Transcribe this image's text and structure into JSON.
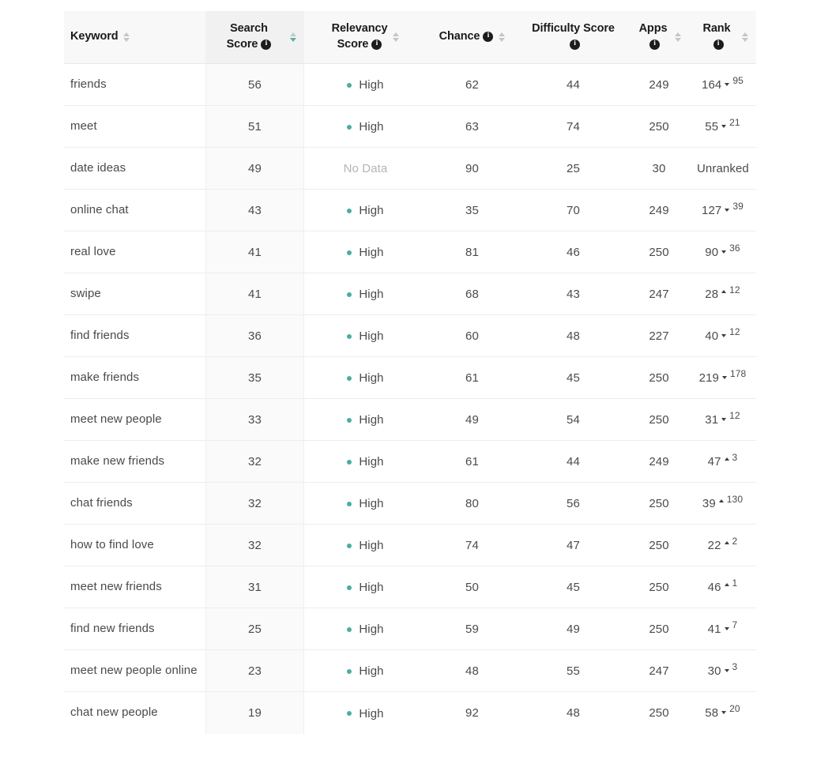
{
  "table": {
    "name": "keyword-research-table",
    "accent_color": "#4aada0",
    "header_bg": "#f8f8f8",
    "active_sort_bg": "#f1f1f1",
    "columns": [
      {
        "key": "keyword",
        "label": "Keyword",
        "has_info": false,
        "sortable": true,
        "active_sort": false,
        "align": "left"
      },
      {
        "key": "search",
        "label": "Search Score",
        "has_info": true,
        "sortable": true,
        "active_sort": true,
        "align": "center"
      },
      {
        "key": "relevancy",
        "label": "Relevancy\nScore",
        "has_info": true,
        "sortable": true,
        "active_sort": false,
        "align": "center"
      },
      {
        "key": "chance",
        "label": "Chance",
        "has_info": true,
        "sortable": true,
        "active_sort": false,
        "align": "center"
      },
      {
        "key": "difficulty",
        "label": "Difficulty Score",
        "has_info": true,
        "sortable": false,
        "active_sort": false,
        "align": "center"
      },
      {
        "key": "apps",
        "label": "Apps",
        "has_info": true,
        "sortable": true,
        "active_sort": false,
        "align": "center"
      },
      {
        "key": "rank",
        "label": "Rank",
        "has_info": true,
        "sortable": true,
        "active_sort": false,
        "align": "center"
      }
    ],
    "icons": {
      "info": "info-icon",
      "sort": "sort-arrows-icon",
      "rank_up": "arrow-up-icon",
      "rank_down": "arrow-down-icon",
      "relevancy_dot": "status-dot-icon"
    },
    "labels": {
      "relevancy_high": "High",
      "relevancy_no_data": "No Data",
      "rank_unranked": "Unranked"
    },
    "rows": [
      {
        "keyword": "friends",
        "search": "56",
        "relevancy": "High",
        "chance": "62",
        "difficulty": "44",
        "apps": "249",
        "rank": "164",
        "rank_dir": "down",
        "rank_delta": "95"
      },
      {
        "keyword": "meet",
        "search": "51",
        "relevancy": "High",
        "chance": "63",
        "difficulty": "74",
        "apps": "250",
        "rank": "55",
        "rank_dir": "down",
        "rank_delta": "21"
      },
      {
        "keyword": "date ideas",
        "search": "49",
        "relevancy": "No Data",
        "chance": "90",
        "difficulty": "25",
        "apps": "30",
        "rank": "Unranked",
        "rank_dir": "none",
        "rank_delta": ""
      },
      {
        "keyword": "online chat",
        "search": "43",
        "relevancy": "High",
        "chance": "35",
        "difficulty": "70",
        "apps": "249",
        "rank": "127",
        "rank_dir": "down",
        "rank_delta": "39"
      },
      {
        "keyword": "real love",
        "search": "41",
        "relevancy": "High",
        "chance": "81",
        "difficulty": "46",
        "apps": "250",
        "rank": "90",
        "rank_dir": "down",
        "rank_delta": "36"
      },
      {
        "keyword": "swipe",
        "search": "41",
        "relevancy": "High",
        "chance": "68",
        "difficulty": "43",
        "apps": "247",
        "rank": "28",
        "rank_dir": "up",
        "rank_delta": "12"
      },
      {
        "keyword": "find friends",
        "search": "36",
        "relevancy": "High",
        "chance": "60",
        "difficulty": "48",
        "apps": "227",
        "rank": "40",
        "rank_dir": "down",
        "rank_delta": "12"
      },
      {
        "keyword": "make friends",
        "search": "35",
        "relevancy": "High",
        "chance": "61",
        "difficulty": "45",
        "apps": "250",
        "rank": "219",
        "rank_dir": "down",
        "rank_delta": "178"
      },
      {
        "keyword": "meet new people",
        "search": "33",
        "relevancy": "High",
        "chance": "49",
        "difficulty": "54",
        "apps": "250",
        "rank": "31",
        "rank_dir": "down",
        "rank_delta": "12"
      },
      {
        "keyword": "make new friends",
        "search": "32",
        "relevancy": "High",
        "chance": "61",
        "difficulty": "44",
        "apps": "249",
        "rank": "47",
        "rank_dir": "up",
        "rank_delta": "3"
      },
      {
        "keyword": "chat friends",
        "search": "32",
        "relevancy": "High",
        "chance": "80",
        "difficulty": "56",
        "apps": "250",
        "rank": "39",
        "rank_dir": "up",
        "rank_delta": "130"
      },
      {
        "keyword": "how to find love",
        "search": "32",
        "relevancy": "High",
        "chance": "74",
        "difficulty": "47",
        "apps": "250",
        "rank": "22",
        "rank_dir": "up",
        "rank_delta": "2"
      },
      {
        "keyword": "meet new friends",
        "search": "31",
        "relevancy": "High",
        "chance": "50",
        "difficulty": "45",
        "apps": "250",
        "rank": "46",
        "rank_dir": "up",
        "rank_delta": "1"
      },
      {
        "keyword": "find new friends",
        "search": "25",
        "relevancy": "High",
        "chance": "59",
        "difficulty": "49",
        "apps": "250",
        "rank": "41",
        "rank_dir": "down",
        "rank_delta": "7"
      },
      {
        "keyword": "meet new people online",
        "search": "23",
        "relevancy": "High",
        "chance": "48",
        "difficulty": "55",
        "apps": "247",
        "rank": "30",
        "rank_dir": "down",
        "rank_delta": "3"
      },
      {
        "keyword": "chat new people",
        "search": "19",
        "relevancy": "High",
        "chance": "92",
        "difficulty": "48",
        "apps": "250",
        "rank": "58",
        "rank_dir": "down",
        "rank_delta": "20"
      }
    ]
  }
}
